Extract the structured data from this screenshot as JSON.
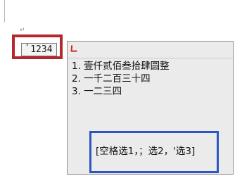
{
  "document": {
    "paragraph_mark": "↵"
  },
  "composition": {
    "apostrophe": "'",
    "input_value": "1234"
  },
  "candidate_window": {
    "logo_icon": "sogou-logo-icon",
    "logo_color": "#d42a1a",
    "candidates": [
      {
        "label": "1. 壹仟贰佰叁拾肆圆整"
      },
      {
        "label": "2. 一千二百三十四"
      },
      {
        "label": "3. 一二三四"
      }
    ],
    "hint": "[空格选1，；选2，'选3]"
  },
  "annotations": {
    "red_highlight_color": "#b3272d",
    "blue_highlight_color": "#2b55c2"
  }
}
